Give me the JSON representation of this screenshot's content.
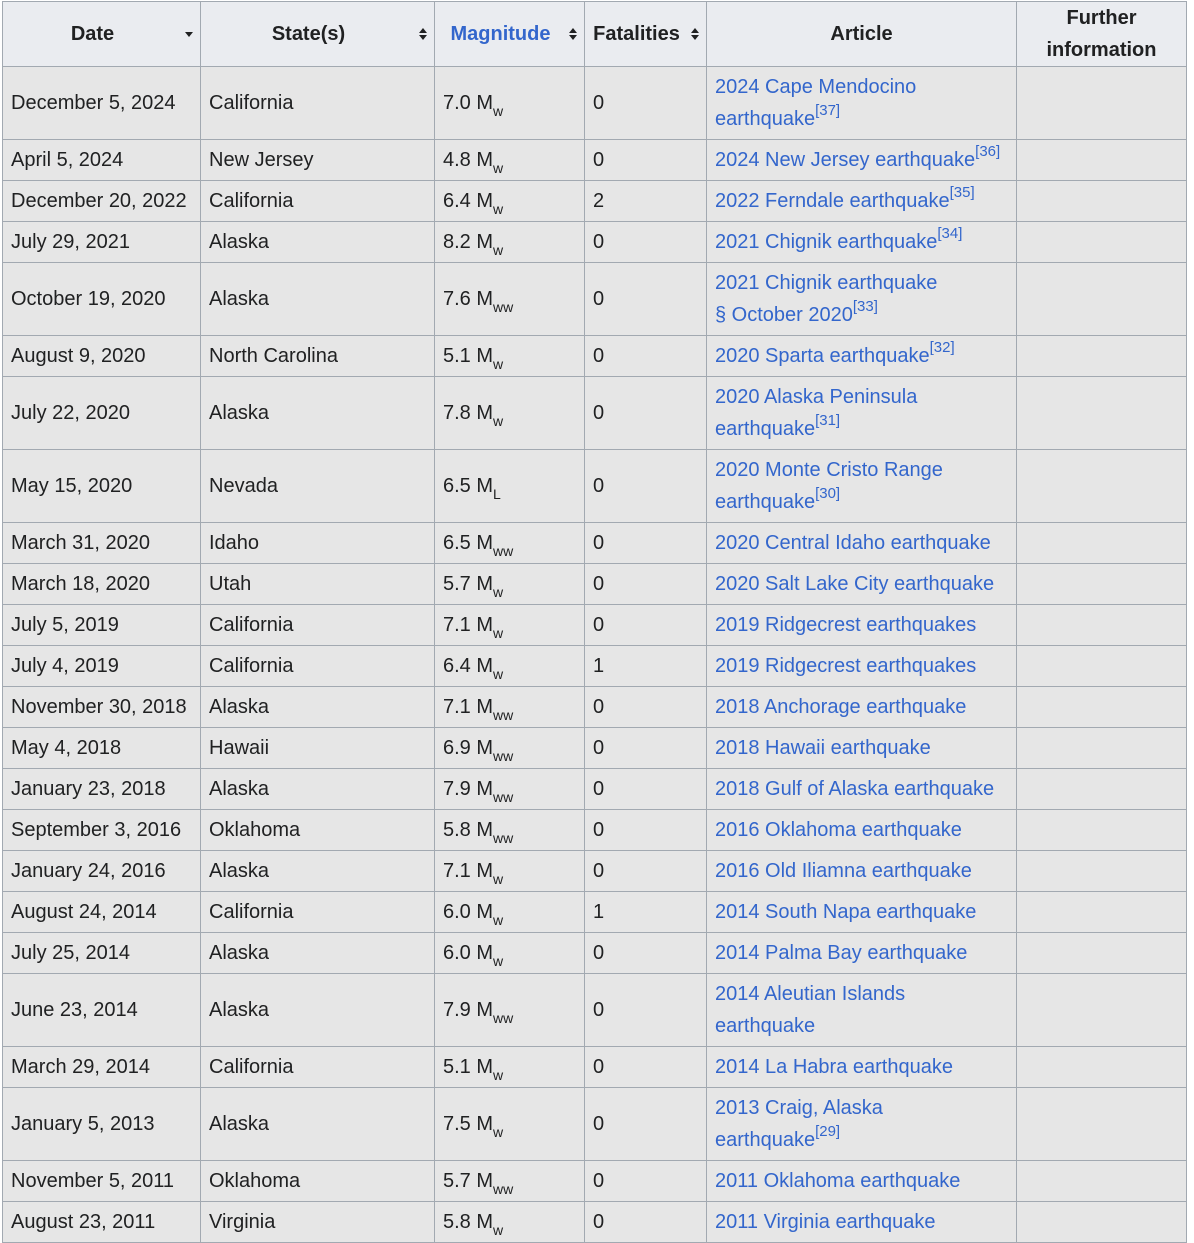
{
  "table": {
    "headers": {
      "date": "Date",
      "states": "State(s)",
      "magnitude": "Magnitude",
      "fatalities": "Fatalities",
      "article": "Article",
      "further": "Further information"
    },
    "rows": [
      {
        "date": "December 5, 2024",
        "state": "California",
        "mag_value": "7.0 M",
        "mag_scale": "w",
        "fatalities": "0",
        "article_line1": "2024 Cape Mendocino",
        "article_line2": "earthquake",
        "ref": "[37]"
      },
      {
        "date": "April 5, 2024",
        "state": "New Jersey",
        "mag_value": "4.8 M",
        "mag_scale": "w",
        "fatalities": "0",
        "article_line1": "2024 New Jersey earthquake",
        "article_line2": "",
        "ref": "[36]"
      },
      {
        "date": "December 20, 2022",
        "state": "California",
        "mag_value": "6.4 M",
        "mag_scale": "w",
        "fatalities": "2",
        "article_line1": "2022 Ferndale earthquake",
        "article_line2": "",
        "ref": "[35]"
      },
      {
        "date": "July 29, 2021",
        "state": "Alaska",
        "mag_value": "8.2 M",
        "mag_scale": "w",
        "fatalities": "0",
        "article_line1": "2021 Chignik earthquake",
        "article_line2": "",
        "ref": "[34]"
      },
      {
        "date": "October 19, 2020",
        "state": "Alaska",
        "mag_value": "7.6 M",
        "mag_scale": "ww",
        "fatalities": "0",
        "article_line1": "2021 Chignik earthquake",
        "article_line2": "§ October 2020",
        "ref": "[33]"
      },
      {
        "date": "August 9, 2020",
        "state": "North Carolina",
        "mag_value": "5.1 M",
        "mag_scale": "w",
        "fatalities": "0",
        "article_line1": "2020 Sparta earthquake",
        "article_line2": "",
        "ref": "[32]"
      },
      {
        "date": "July 22, 2020",
        "state": "Alaska",
        "mag_value": "7.8 M",
        "mag_scale": "w",
        "fatalities": "0",
        "article_line1": "2020 Alaska Peninsula",
        "article_line2": "earthquake",
        "ref": "[31]"
      },
      {
        "date": "May 15, 2020",
        "state": "Nevada",
        "mag_value": "6.5 M",
        "mag_scale": "L",
        "fatalities": "0",
        "article_line1": "2020 Monte Cristo Range",
        "article_line2": "earthquake",
        "ref": "[30]"
      },
      {
        "date": "March 31, 2020",
        "state": "Idaho",
        "mag_value": "6.5 M",
        "mag_scale": "ww",
        "fatalities": "0",
        "article_line1": "2020 Central Idaho earthquake",
        "article_line2": "",
        "ref": ""
      },
      {
        "date": "March 18, 2020",
        "state": "Utah",
        "mag_value": "5.7 M",
        "mag_scale": "w",
        "fatalities": "0",
        "article_line1": "2020 Salt Lake City earthquake",
        "article_line2": "",
        "ref": ""
      },
      {
        "date": "July 5, 2019",
        "state": "California",
        "mag_value": "7.1 M",
        "mag_scale": "w",
        "fatalities": "0",
        "article_line1": "2019 Ridgecrest earthquakes",
        "article_line2": "",
        "ref": ""
      },
      {
        "date": "July 4, 2019",
        "state": "California",
        "mag_value": "6.4 M",
        "mag_scale": "w",
        "fatalities": "1",
        "article_line1": "2019 Ridgecrest earthquakes",
        "article_line2": "",
        "ref": ""
      },
      {
        "date": "November 30, 2018",
        "state": "Alaska",
        "mag_value": "7.1 M",
        "mag_scale": "ww",
        "fatalities": "0",
        "article_line1": "2018 Anchorage earthquake",
        "article_line2": "",
        "ref": ""
      },
      {
        "date": "May 4, 2018",
        "state": "Hawaii",
        "mag_value": "6.9 M",
        "mag_scale": "ww",
        "fatalities": "0",
        "article_line1": "2018 Hawaii earthquake",
        "article_line2": "",
        "ref": ""
      },
      {
        "date": "January 23, 2018",
        "state": "Alaska",
        "mag_value": "7.9 M",
        "mag_scale": "ww",
        "fatalities": "0",
        "article_line1": "2018 Gulf of Alaska earthquake",
        "article_line2": "",
        "ref": ""
      },
      {
        "date": "September 3, 2016",
        "state": "Oklahoma",
        "mag_value": "5.8 M",
        "mag_scale": "ww",
        "fatalities": "0",
        "article_line1": "2016 Oklahoma earthquake",
        "article_line2": "",
        "ref": ""
      },
      {
        "date": "January 24, 2016",
        "state": "Alaska",
        "mag_value": "7.1 M",
        "mag_scale": "w",
        "fatalities": "0",
        "article_line1": "2016 Old Iliamna earthquake",
        "article_line2": "",
        "ref": ""
      },
      {
        "date": "August 24, 2014",
        "state": "California",
        "mag_value": "6.0 M",
        "mag_scale": "w",
        "fatalities": "1",
        "article_line1": "2014 South Napa earthquake",
        "article_line2": "",
        "ref": ""
      },
      {
        "date": "July 25, 2014",
        "state": "Alaska",
        "mag_value": "6.0 M",
        "mag_scale": "w",
        "fatalities": "0",
        "article_line1": "2014 Palma Bay earthquake",
        "article_line2": "",
        "ref": ""
      },
      {
        "date": "June 23, 2014",
        "state": "Alaska",
        "mag_value": "7.9 M",
        "mag_scale": "ww",
        "fatalities": "0",
        "article_line1": "2014 Aleutian Islands",
        "article_line2": "earthquake",
        "ref": ""
      },
      {
        "date": "March 29, 2014",
        "state": "California",
        "mag_value": "5.1 M",
        "mag_scale": "w",
        "fatalities": "0",
        "article_line1": "2014 La Habra earthquake",
        "article_line2": "",
        "ref": ""
      },
      {
        "date": "January 5, 2013",
        "state": "Alaska",
        "mag_value": "7.5 M",
        "mag_scale": "w",
        "fatalities": "0",
        "article_line1": "2013 Craig, Alaska",
        "article_line2": "earthquake",
        "ref": "[29]"
      },
      {
        "date": "November 5, 2011",
        "state": "Oklahoma",
        "mag_value": "5.7 M",
        "mag_scale": "ww",
        "fatalities": "0",
        "article_line1": "2011 Oklahoma earthquake",
        "article_line2": "",
        "ref": ""
      },
      {
        "date": "August 23, 2011",
        "state": "Virginia",
        "mag_value": "5.8 M",
        "mag_scale": "w",
        "fatalities": "0",
        "article_line1": "2011 Virginia earthquake",
        "article_line2": "",
        "ref": ""
      }
    ]
  },
  "icons": {
    "date_sort": "sort-descending-icon",
    "column_sort": "sort-both-icon"
  },
  "colors": {
    "link": "#3366cc",
    "header_bg": "#eaecf0",
    "cell_bg": "#e6e6e6",
    "border": "#a2a9b1"
  }
}
